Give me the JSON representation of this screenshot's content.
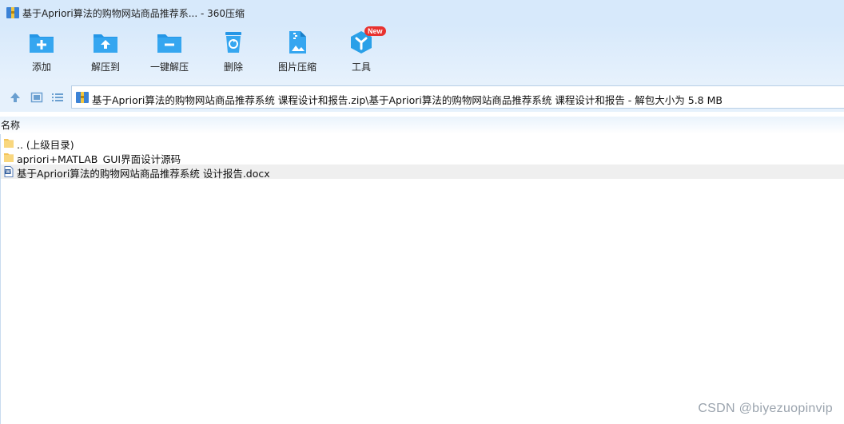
{
  "window": {
    "title": "基于Apriori算法的购物网站商品推荐系... - 360压缩"
  },
  "toolbar": {
    "items": [
      {
        "label": "添加",
        "icon": "add-folder-icon"
      },
      {
        "label": "解压到",
        "icon": "extract-to-icon"
      },
      {
        "label": "一键解压",
        "icon": "one-click-extract-icon"
      },
      {
        "label": "删除",
        "icon": "recycle-bin-icon"
      },
      {
        "label": "图片压缩",
        "icon": "image-compress-icon"
      },
      {
        "label": "工具",
        "icon": "tools-icon",
        "badge": "New"
      }
    ],
    "accent_color": "#2aa0e8"
  },
  "address": {
    "path": "基于Apriori算法的购物网站商品推荐系统 课程设计和报告.zip\\基于Apriori算法的购物网站商品推荐系统 课程设计和报告 - 解包大小为 5.8 MB"
  },
  "file_list": {
    "column_name": "名称",
    "rows": [
      {
        "name": ".. (上级目录)",
        "type": "folder",
        "selected": false
      },
      {
        "name": "apriori+MATLAB_GUI界面设计源码",
        "type": "folder",
        "selected": false
      },
      {
        "name": "基于Apriori算法的购物网站商品推荐系统 设计报告.docx",
        "type": "word-document",
        "selected": true
      }
    ]
  },
  "watermark": "CSDN @biyezuopinvip"
}
